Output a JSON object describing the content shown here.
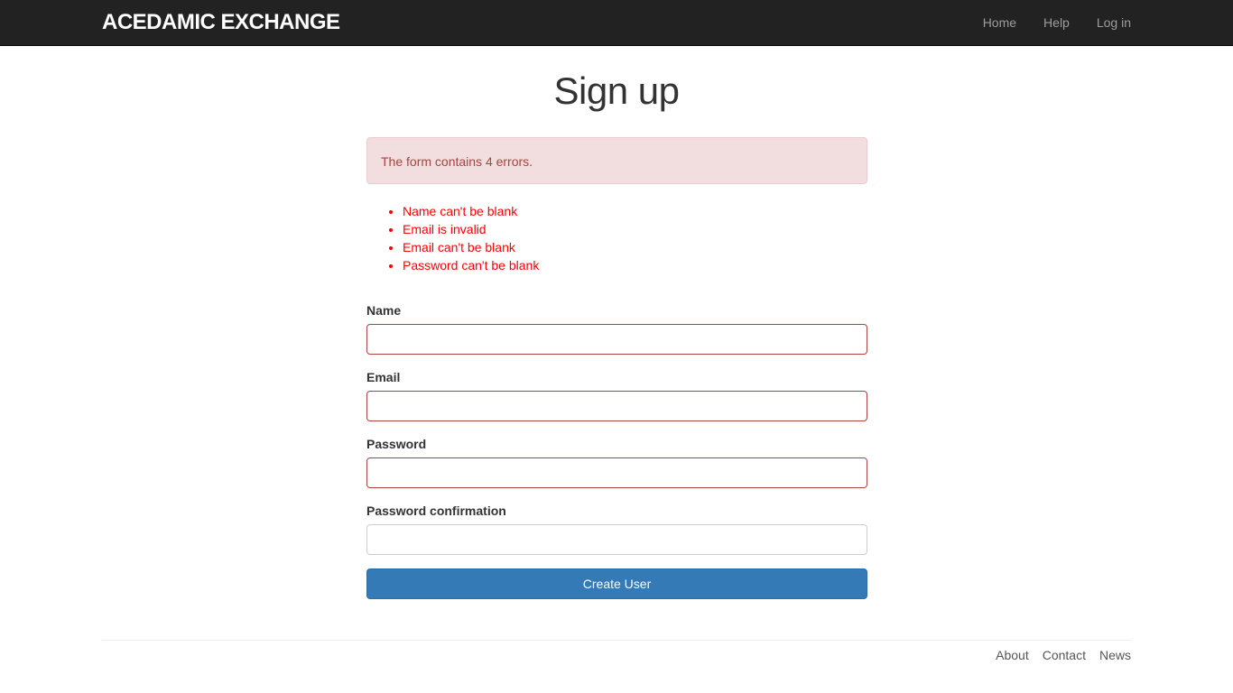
{
  "navbar": {
    "brand": "ACEDAMIC EXCHANGE",
    "links": [
      "Home",
      "Help",
      "Log in"
    ],
    "background": "#222222"
  },
  "page_title": "Sign up",
  "alert": {
    "message": "The form contains 4 errors.",
    "background": "#f2dede",
    "color": "#a94442"
  },
  "errors": [
    "Name can't be blank",
    "Email is invalid",
    "Email can't be blank",
    "Password can't be blank"
  ],
  "form": {
    "fields": [
      {
        "label": "Name",
        "value": "",
        "has_error": true
      },
      {
        "label": "Email",
        "value": "",
        "has_error": true
      },
      {
        "label": "Password",
        "value": "",
        "has_error": true
      },
      {
        "label": "Password confirmation",
        "value": "",
        "has_error": false
      }
    ],
    "submit_label": "Create User",
    "submit_color": "#337ab7"
  },
  "footer": {
    "links": [
      "About",
      "Contact",
      "News"
    ]
  }
}
